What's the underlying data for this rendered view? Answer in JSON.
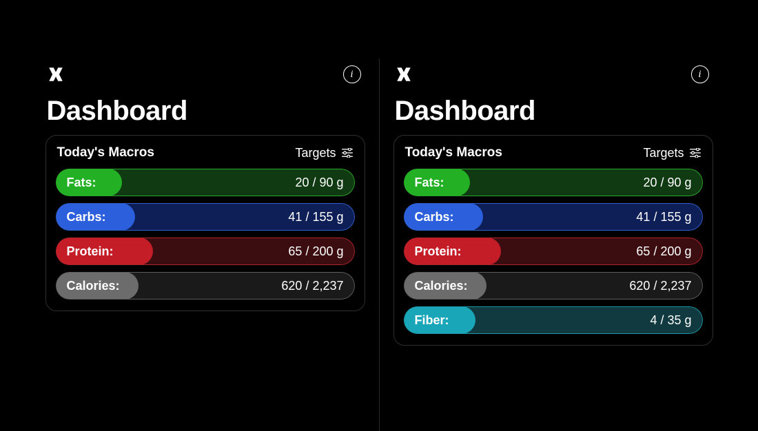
{
  "pageTitle": "Dashboard",
  "card": {
    "title": "Today's Macros",
    "targetsLabel": "Targets"
  },
  "macros": {
    "fats": {
      "label": "Fats:",
      "value": "20 / 90 g"
    },
    "carbs": {
      "label": "Carbs:",
      "value": "41 / 155 g"
    },
    "protein": {
      "label": "Protein:",
      "value": "65 / 200 g"
    },
    "calories": {
      "label": "Calories:",
      "value": "620 / 2,237"
    },
    "fiber": {
      "label": "Fiber:",
      "value": "4 / 35 g"
    }
  },
  "chart_data": [
    {
      "type": "bar",
      "title": "Today's Macros (basic)",
      "series": [
        {
          "name": "Fats",
          "current": 20,
          "target": 90,
          "unit": "g"
        },
        {
          "name": "Carbs",
          "current": 41,
          "target": 155,
          "unit": "g"
        },
        {
          "name": "Protein",
          "current": 65,
          "target": 200,
          "unit": "g"
        },
        {
          "name": "Calories",
          "current": 620,
          "target": 2237,
          "unit": ""
        }
      ]
    },
    {
      "type": "bar",
      "title": "Today's Macros (with fiber)",
      "series": [
        {
          "name": "Fats",
          "current": 20,
          "target": 90,
          "unit": "g"
        },
        {
          "name": "Carbs",
          "current": 41,
          "target": 155,
          "unit": "g"
        },
        {
          "name": "Protein",
          "current": 65,
          "target": 200,
          "unit": "g"
        },
        {
          "name": "Calories",
          "current": 620,
          "target": 2237,
          "unit": ""
        },
        {
          "name": "Fiber",
          "current": 4,
          "target": 35,
          "unit": "g"
        }
      ]
    }
  ]
}
